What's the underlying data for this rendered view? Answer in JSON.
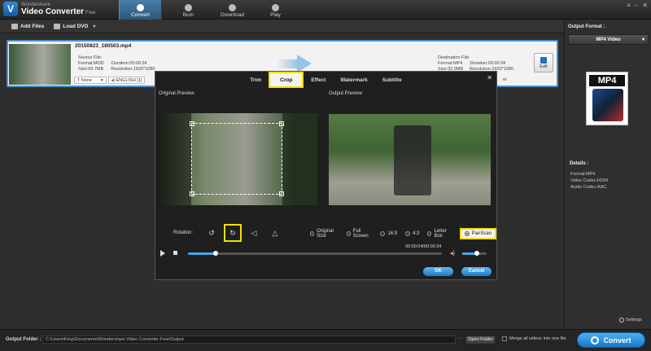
{
  "app": {
    "brand_small": "Wondershare",
    "brand_main": "Video Converter",
    "brand_edition": "Free"
  },
  "nav": {
    "convert": "Convert",
    "burn": "Burn",
    "download": "Download",
    "play": "Play"
  },
  "toolbar": {
    "add_files": "Add Files",
    "load_dvd": "Load DVD"
  },
  "file": {
    "name": "20150823_180503.mp4",
    "source_label": "Source File:",
    "source_format": "Format:MOD",
    "source_duration": "Duration:00:00:34",
    "source_size": "Size:69.7MB",
    "source_resolution": "Resolution:1920*1080",
    "dest_label": "Destination File:",
    "dest_format": "Format:MP4",
    "dest_duration": "Duration:00:00:34",
    "dest_size": "Size:32.9MB",
    "dest_resolution": "Resolution:1920*1080",
    "edit": "Edit",
    "subtitle_value": "None",
    "audio_value": "ENGLISH [1]",
    "tail_text": "er"
  },
  "right_panel": {
    "output_format_label": "Output Format :",
    "format_value": "MP4 Video",
    "icon_label": "MP4",
    "details_label": "Details :",
    "detail_format": "Format:MP4",
    "detail_video": "Video Codec:H264",
    "detail_audio": "Audio Codec:AAC",
    "settings": "Settings"
  },
  "bottom": {
    "output_folder_label": "Output Folder :",
    "output_path": "C:\\Users\\King\\Documents\\Wondershare Video Converter Free\\Output",
    "open_folder": "Open Folder",
    "merge_label": "Merge all videos into one file",
    "convert": "Convert"
  },
  "modal": {
    "tabs": [
      "Trim",
      "Crop",
      "Effect",
      "Watermark",
      "Subtitle"
    ],
    "original_preview": "Original Preview",
    "output_preview": "Output Preview",
    "rotation_label": "Rotation:",
    "ratios": [
      "Original Size",
      "Full Screen",
      "16:9",
      "4:3",
      "Letter Box",
      "PanScan"
    ],
    "time": "00:00:04/00:00:34",
    "progress_fraction": 0.11,
    "volume_fraction": 0.6,
    "ok": "OK",
    "cancel": "Cancel"
  },
  "colors": {
    "accent_blue": "#1a7ac8",
    "highlight_yellow": "#f2e000"
  }
}
